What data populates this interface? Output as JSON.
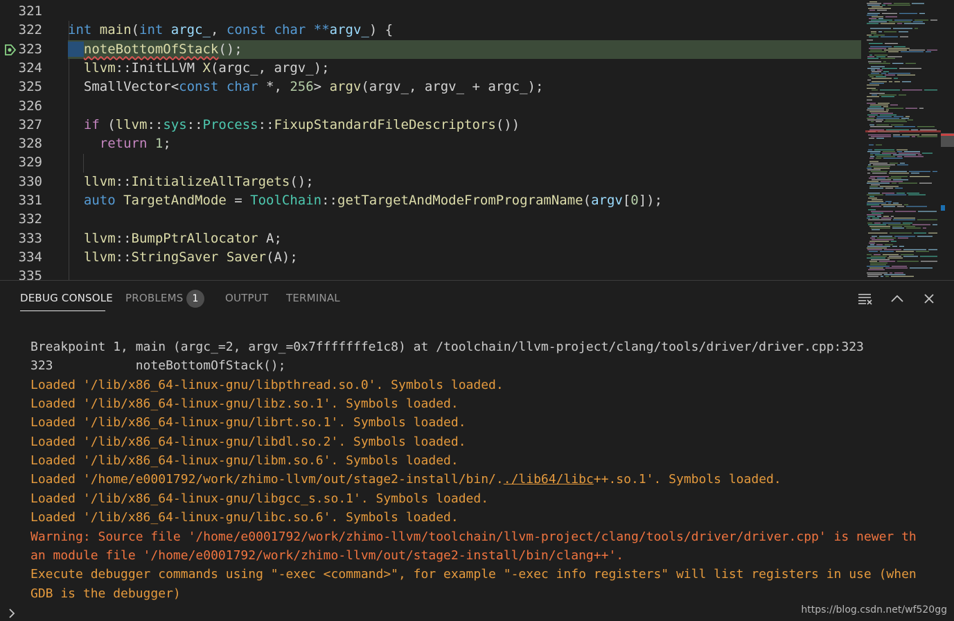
{
  "editor": {
    "lines": [
      {
        "num": "321",
        "tokens": []
      },
      {
        "num": "322",
        "tokens": [
          {
            "c": "t-kw",
            "t": "int"
          },
          {
            "c": "t-plain",
            "t": " "
          },
          {
            "c": "t-fn",
            "t": "main"
          },
          {
            "c": "t-plain",
            "t": "("
          },
          {
            "c": "t-kw",
            "t": "int"
          },
          {
            "c": "t-plain",
            "t": " "
          },
          {
            "c": "t-var",
            "t": "argc_"
          },
          {
            "c": "t-plain",
            "t": ", "
          },
          {
            "c": "t-kw",
            "t": "const"
          },
          {
            "c": "t-plain",
            "t": " "
          },
          {
            "c": "t-kw",
            "t": "char"
          },
          {
            "c": "t-plain",
            "t": " "
          },
          {
            "c": "t-kw",
            "t": "**"
          },
          {
            "c": "t-var",
            "t": "argv_"
          },
          {
            "c": "t-plain",
            "t": ") {"
          }
        ]
      },
      {
        "num": "323",
        "tokens": [
          {
            "c": "t-plain sel",
            "t": "  "
          },
          {
            "c": "t-fn squiggle",
            "t": "noteBottomOfStack"
          },
          {
            "c": "t-plain",
            "t": "();"
          }
        ]
      },
      {
        "num": "324",
        "tokens": [
          {
            "c": "t-plain",
            "t": "  "
          },
          {
            "c": "t-fn",
            "t": "llvm"
          },
          {
            "c": "t-plain",
            "t": "::InitLLVM "
          },
          {
            "c": "t-fn",
            "t": "X"
          },
          {
            "c": "t-plain",
            "t": "(argc_, argv_);"
          }
        ]
      },
      {
        "num": "325",
        "tokens": [
          {
            "c": "t-plain",
            "t": "  SmallVector<"
          },
          {
            "c": "t-kw",
            "t": "const"
          },
          {
            "c": "t-plain",
            "t": " "
          },
          {
            "c": "t-kw",
            "t": "char"
          },
          {
            "c": "t-plain",
            "t": " *, "
          },
          {
            "c": "t-num",
            "t": "256"
          },
          {
            "c": "t-plain",
            "t": "> "
          },
          {
            "c": "t-fn",
            "t": "argv"
          },
          {
            "c": "t-plain",
            "t": "(argv_, argv_ + argc_);"
          }
        ]
      },
      {
        "num": "326",
        "tokens": []
      },
      {
        "num": "327",
        "tokens": [
          {
            "c": "t-plain",
            "t": "  "
          },
          {
            "c": "t-ctl",
            "t": "if"
          },
          {
            "c": "t-plain",
            "t": " ("
          },
          {
            "c": "t-fn",
            "t": "llvm"
          },
          {
            "c": "t-plain",
            "t": "::"
          },
          {
            "c": "t-type",
            "t": "sys"
          },
          {
            "c": "t-plain",
            "t": "::"
          },
          {
            "c": "t-type",
            "t": "Process"
          },
          {
            "c": "t-plain",
            "t": "::"
          },
          {
            "c": "t-fn",
            "t": "FixupStandardFileDescriptors"
          },
          {
            "c": "t-plain",
            "t": "())"
          }
        ]
      },
      {
        "num": "328",
        "tokens": [
          {
            "c": "t-plain",
            "t": "    "
          },
          {
            "c": "t-ctl",
            "t": "return"
          },
          {
            "c": "t-plain",
            "t": " "
          },
          {
            "c": "t-num",
            "t": "1"
          },
          {
            "c": "t-plain",
            "t": ";"
          }
        ]
      },
      {
        "num": "329",
        "tokens": []
      },
      {
        "num": "330",
        "tokens": [
          {
            "c": "t-plain",
            "t": "  "
          },
          {
            "c": "t-fn",
            "t": "llvm"
          },
          {
            "c": "t-plain",
            "t": "::"
          },
          {
            "c": "t-fn",
            "t": "InitializeAllTargets"
          },
          {
            "c": "t-plain",
            "t": "();"
          }
        ]
      },
      {
        "num": "331",
        "tokens": [
          {
            "c": "t-plain",
            "t": "  "
          },
          {
            "c": "t-kw",
            "t": "auto"
          },
          {
            "c": "t-plain",
            "t": " "
          },
          {
            "c": "t-fn",
            "t": "TargetAndMode"
          },
          {
            "c": "t-plain",
            "t": " = "
          },
          {
            "c": "t-type",
            "t": "ToolChain"
          },
          {
            "c": "t-plain",
            "t": "::"
          },
          {
            "c": "t-fn",
            "t": "getTargetAndModeFromProgramName"
          },
          {
            "c": "t-plain",
            "t": "("
          },
          {
            "c": "t-var",
            "t": "argv"
          },
          {
            "c": "t-plain",
            "t": "["
          },
          {
            "c": "t-num",
            "t": "0"
          },
          {
            "c": "t-plain",
            "t": "]);"
          }
        ]
      },
      {
        "num": "332",
        "tokens": []
      },
      {
        "num": "333",
        "tokens": [
          {
            "c": "t-plain",
            "t": "  "
          },
          {
            "c": "t-fn",
            "t": "llvm"
          },
          {
            "c": "t-plain",
            "t": "::"
          },
          {
            "c": "t-fn",
            "t": "BumpPtrAllocator"
          },
          {
            "c": "t-plain",
            "t": " A;"
          }
        ]
      },
      {
        "num": "334",
        "tokens": [
          {
            "c": "t-plain",
            "t": "  "
          },
          {
            "c": "t-fn",
            "t": "llvm"
          },
          {
            "c": "t-plain",
            "t": "::"
          },
          {
            "c": "t-fn",
            "t": "StringSaver"
          },
          {
            "c": "t-plain",
            "t": " "
          },
          {
            "c": "t-fn",
            "t": "Saver"
          },
          {
            "c": "t-plain",
            "t": "(A);"
          }
        ]
      },
      {
        "num": "335",
        "tokens": []
      }
    ]
  },
  "panel": {
    "tabs": {
      "debug_console": "DEBUG CONSOLE",
      "problems": "PROBLEMS",
      "problems_count": "1",
      "output": "OUTPUT",
      "terminal": "TERMINAL"
    },
    "console": [
      {
        "cls": "c-normal",
        "text": "Breakpoint 1, main (argc_=2, argv_=0x7fffffffe1c8) at /toolchain/llvm-project/clang/tools/driver/driver.cpp:323"
      },
      {
        "cls": "c-normal",
        "text": "323\t    noteBottomOfStack();"
      },
      {
        "cls": "c-loaded",
        "text": "Loaded '/lib/x86_64-linux-gnu/libpthread.so.0'. Symbols loaded."
      },
      {
        "cls": "c-loaded",
        "text": "Loaded '/lib/x86_64-linux-gnu/libz.so.1'. Symbols loaded."
      },
      {
        "cls": "c-loaded",
        "text": "Loaded '/lib/x86_64-linux-gnu/librt.so.1'. Symbols loaded."
      },
      {
        "cls": "c-loaded",
        "text": "Loaded '/lib/x86_64-linux-gnu/libdl.so.2'. Symbols loaded."
      },
      {
        "cls": "c-loaded",
        "text": "Loaded '/lib/x86_64-linux-gnu/libm.so.6'. Symbols loaded."
      },
      {
        "cls": "c-loaded",
        "pre": "Loaded '/home/e0001792/work/zhimo-llvm/out/stage2-install/bin/.",
        "link": "./lib64/libc",
        "post": "++.so.1'. Symbols loaded."
      },
      {
        "cls": "c-loaded",
        "text": "Loaded '/lib/x86_64-linux-gnu/libgcc_s.so.1'. Symbols loaded."
      },
      {
        "cls": "c-loaded",
        "text": "Loaded '/lib/x86_64-linux-gnu/libc.so.6'. Symbols loaded."
      },
      {
        "cls": "c-warn",
        "text": "Warning: Source file '/home/e0001792/work/zhimo-llvm/toolchain/llvm-project/clang/tools/driver/driver.cpp' is newer th"
      },
      {
        "cls": "c-warn",
        "text": "an module file '/home/e0001792/work/zhimo-llvm/out/stage2-install/bin/clang++'."
      },
      {
        "cls": "c-exec",
        "text": "Execute debugger commands using \"-exec <command>\", for example \"-exec info registers\" will list registers in use (when"
      },
      {
        "cls": "c-exec",
        "text": "GDB is the debugger)"
      }
    ],
    "watermark": "https://blog.csdn.net/wf520gg"
  },
  "icons": {
    "breakpoint": "breakpoint-arrow-icon",
    "clear": "clear-console-icon",
    "maximize": "chevron-up-icon",
    "close": "close-icon",
    "prompt": "chevron-right-icon"
  },
  "colors": {
    "background": "#1e1e1e",
    "current_line": "#3c4b39",
    "loaded_text": "#e59a3d",
    "warning_text": "#f0743f",
    "breakpoint": "#89d185"
  }
}
